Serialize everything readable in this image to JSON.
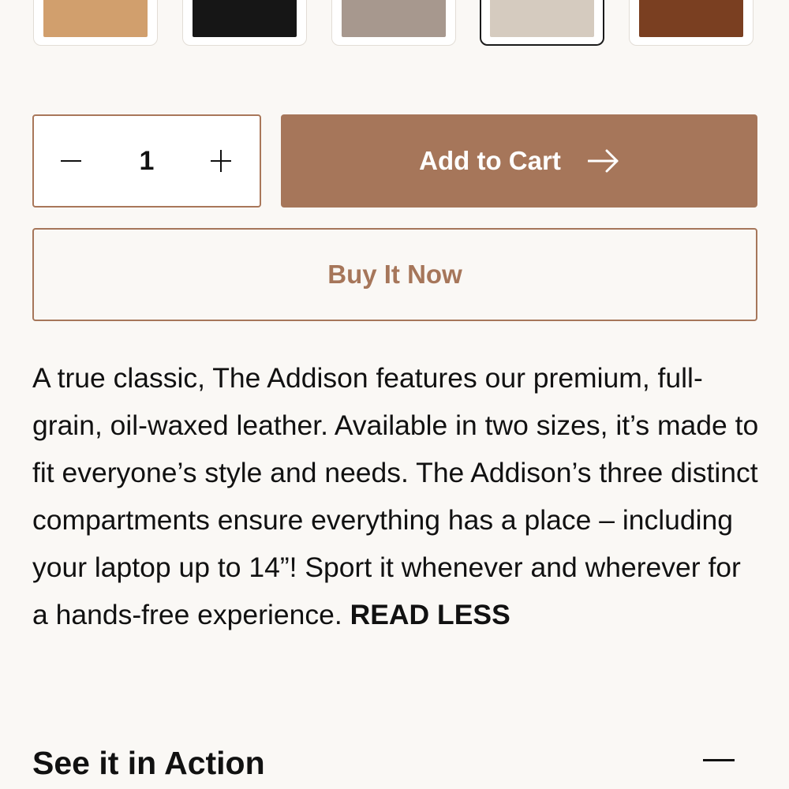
{
  "swatches": [
    {
      "name": "tan",
      "color": "#d19f6d"
    },
    {
      "name": "black",
      "color": "#161616"
    },
    {
      "name": "taupe",
      "color": "#a7988e"
    },
    {
      "name": "stone",
      "color": "#d5cbbf",
      "selected": true
    },
    {
      "name": "chestnut",
      "color": "#7a3f21"
    }
  ],
  "quantity": {
    "value": "1",
    "decrement_icon": "minus-icon",
    "increment_icon": "plus-icon"
  },
  "buttons": {
    "add_to_cart": "Add to Cart",
    "add_to_cart_icon": "arrow-right-icon",
    "buy_now": "Buy It Now"
  },
  "description": {
    "text": "A true classic, The Addison features our premium, full-grain, oil-waxed leather. Available in two sizes, it’s made to fit everyone’s style and needs. The Addison’s three distinct compartments ensure everything has a place – including your laptop up to 14”! Sport it whenever and wherever for a hands-free experience.",
    "toggle": "READ LESS"
  },
  "accordion": {
    "title": "See it in Action",
    "icon": "minus-icon"
  },
  "colors": {
    "accent": "#a6765a",
    "background": "#faf8f5",
    "text": "#111111"
  }
}
